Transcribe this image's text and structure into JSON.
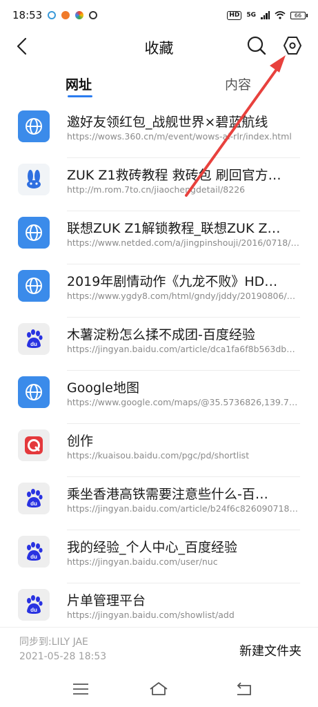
{
  "status": {
    "time": "18:53",
    "network": "5G",
    "battery": "66"
  },
  "header": {
    "title": "收藏"
  },
  "tabs": [
    {
      "label": "网址",
      "active": true
    },
    {
      "label": "内容",
      "active": false
    }
  ],
  "items": [
    {
      "title": "邀好友领红包_战舰世界×碧蓝航线",
      "url": "https://wows.360.cn/m/event/wows-al-rlr/index.html",
      "icon": "globe-icon"
    },
    {
      "title": "ZUK Z1救砖教程 救砖包 刷回官方…",
      "url": "http://m.rom.7to.cn/jiaochengdetail/8226",
      "icon": "zuk-rabbit-icon"
    },
    {
      "title": "联想ZUK Z1解锁教程_联想ZUK Z…",
      "url": "https://www.netded.com/a/jingpinshouji/2016/0718/…",
      "icon": "globe-icon"
    },
    {
      "title": "2019年剧情动作《九龙不败》HD…",
      "url": "https://www.ygdy8.com/html/gndy/jddy/20190806/…",
      "icon": "globe-icon"
    },
    {
      "title": "木薯淀粉怎么揉不成团-百度经验",
      "url": "https://jingyan.baidu.com/article/dca1fa6f8b563db0…",
      "icon": "baidu-paw-icon"
    },
    {
      "title": "Google地图",
      "url": "https://www.google.com/maps/@35.5736826,139.7…",
      "icon": "globe-icon"
    },
    {
      "title": "创作",
      "url": "https://kuaisou.baidu.com/pgc/pd/shortlist",
      "icon": "kuaisou-icon"
    },
    {
      "title": "乘坐香港高铁需要注意些什么-百…",
      "url": "https://jingyan.baidu.com/article/b24f6c8260907186…",
      "icon": "baidu-paw-icon"
    },
    {
      "title": "我的经验_个人中心_百度经验",
      "url": "https://jingyan.baidu.com/user/nuc",
      "icon": "baidu-paw-icon"
    },
    {
      "title": "片单管理平台",
      "url": "https://jingyan.baidu.com/showlist/add",
      "icon": "baidu-paw-icon"
    }
  ],
  "footer": {
    "sync_label": "同步到:LILY JAE",
    "sync_date": "2021-05-28 18:53",
    "new_folder": "新建文件夹"
  },
  "colors": {
    "accent": "#2b7cf0",
    "globe_bg": "#3b8bea",
    "baidu_blue": "#2932e1",
    "arrow_red": "#e8413d"
  }
}
